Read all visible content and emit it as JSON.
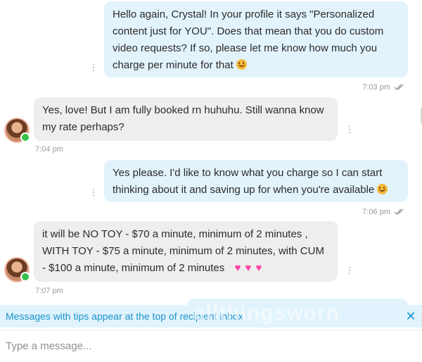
{
  "conversation": {
    "messages": [
      {
        "direction": "outgoing",
        "lines": [
          "Hello again, Crystal! In your profile it says \"Personalized",
          "content just for YOU\". Does that mean that you do custom",
          "video requests? If so, please let me know how much you",
          "charge per minute for that"
        ],
        "trailing_emoji": "smiling-face-emoji",
        "time": "7:03 pm",
        "status": "read"
      },
      {
        "direction": "incoming",
        "lines": [
          "Yes, love! But I am fully booked rn huhuhu. Still wanna know",
          "my rate perhaps?"
        ],
        "time": "7:04 pm"
      },
      {
        "direction": "outgoing",
        "lines": [
          "Yes please. I'd like to know what you charge so I can start",
          "thinking about it and saving up for when you're available"
        ],
        "trailing_emoji": "smiling-face-emoji",
        "time": "7:06 pm",
        "status": "read"
      },
      {
        "direction": "incoming",
        "lines": [
          "it will be NO TOY - $70 a minute, minimum of 2 minutes ,",
          "WITH TOY - $75 a minute, minimum of 2 minutes, with CUM",
          "- $100 a minute, minimum of 2 minutes"
        ],
        "trailing_emoji": "pink-heart-emoji",
        "time": "7:07 pm"
      }
    ]
  },
  "tip_banner": {
    "text": "Messages with tips appear at the top of recipient inbox",
    "close_glyph": "✕"
  },
  "watermark": {
    "text": "allthingsworn"
  },
  "composer": {
    "placeholder": "Type a message..."
  },
  "icons": {
    "kebab": "⋮",
    "heart": "♥",
    "read_ticks": "double-check-icon"
  },
  "colors": {
    "outgoing_bubble": "#e2f3fb",
    "incoming_bubble": "#eeeeee",
    "banner_bg": "#e1f3fc",
    "banner_text": "#1a93cf",
    "online_dot": "#36c24a",
    "heart": "#ff3fa4"
  }
}
